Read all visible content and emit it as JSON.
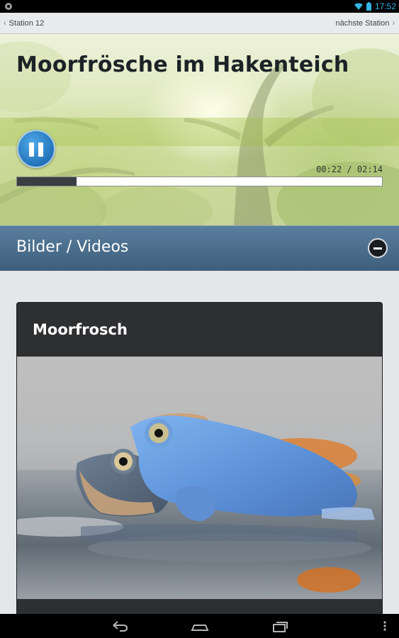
{
  "status_bar": {
    "time": "17:52",
    "icons": [
      "android-debug-icon",
      "wifi-icon",
      "battery-icon"
    ]
  },
  "nav": {
    "back_label": "Station 12",
    "next_label": "nächste Station"
  },
  "hero": {
    "title": "Moorfrösche im Hakenteich",
    "player": {
      "state": "playing",
      "time_display": "00:22 / 02:14",
      "progress": 0.164
    }
  },
  "section": {
    "title": "Bilder / Videos",
    "expanded": true
  },
  "media_card": {
    "title": "Moorfrosch"
  },
  "system_nav": {
    "buttons": [
      "back-icon",
      "home-icon",
      "recent-apps-icon",
      "overflow-menu-icon"
    ]
  },
  "colors": {
    "accent": "#33b5e5",
    "section_header": "#4a6d8c",
    "card_bg": "#2e2f31",
    "play_button": "#2a80c8"
  }
}
